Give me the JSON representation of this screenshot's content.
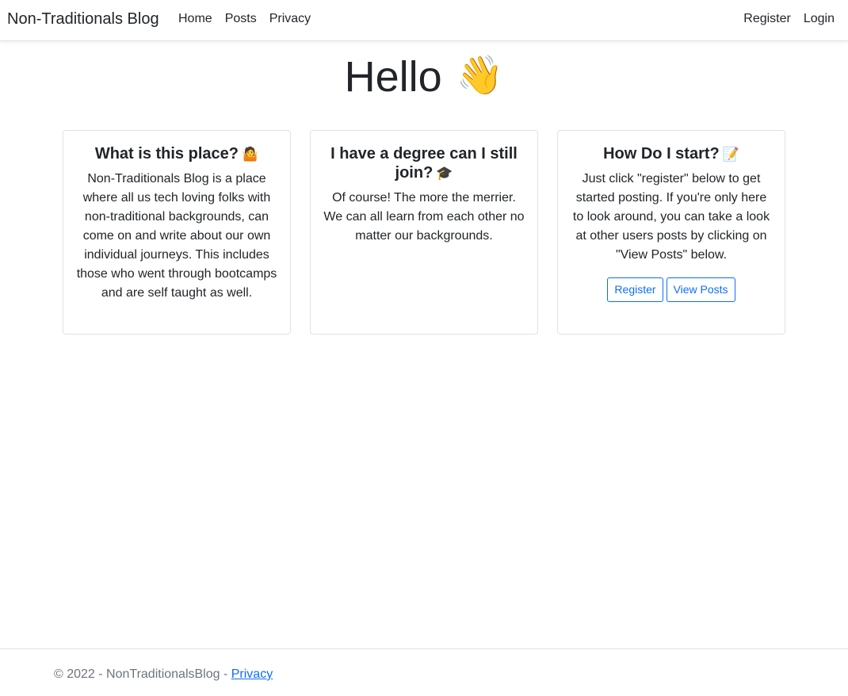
{
  "navbar": {
    "brand": "Non-Traditionals Blog",
    "left_links": [
      "Home",
      "Posts",
      "Privacy"
    ],
    "right_links": [
      "Register",
      "Login"
    ]
  },
  "hero": {
    "title": "Hello",
    "emoji": "👋"
  },
  "cards": [
    {
      "title": "What is this place?",
      "emoji": "🤷",
      "text": "Non-Traditionals Blog is a place where all us tech loving folks with non-traditional backgrounds, can come on and write about our own individual journeys. This includes those who went through bootcamps and are self taught as well."
    },
    {
      "title": "I have a degree can I still join?",
      "emoji": "🎓",
      "text": "Of course! The more the merrier. We can all learn from each other no matter our backgrounds."
    },
    {
      "title": "How Do I start?",
      "emoji": "📝",
      "text": "Just click \"register\" below to get started posting. If you're only here to look around, you can take a look at other users posts by clicking on \"View Posts\" below.",
      "buttons": [
        "Register",
        "View Posts"
      ]
    }
  ],
  "footer": {
    "text": "© 2022 - NonTraditionalsBlog - ",
    "link": "Privacy"
  },
  "colors": {
    "primary": "#0d6efd",
    "text": "#212529",
    "muted": "#6c757d",
    "border": "#dee2e6"
  }
}
